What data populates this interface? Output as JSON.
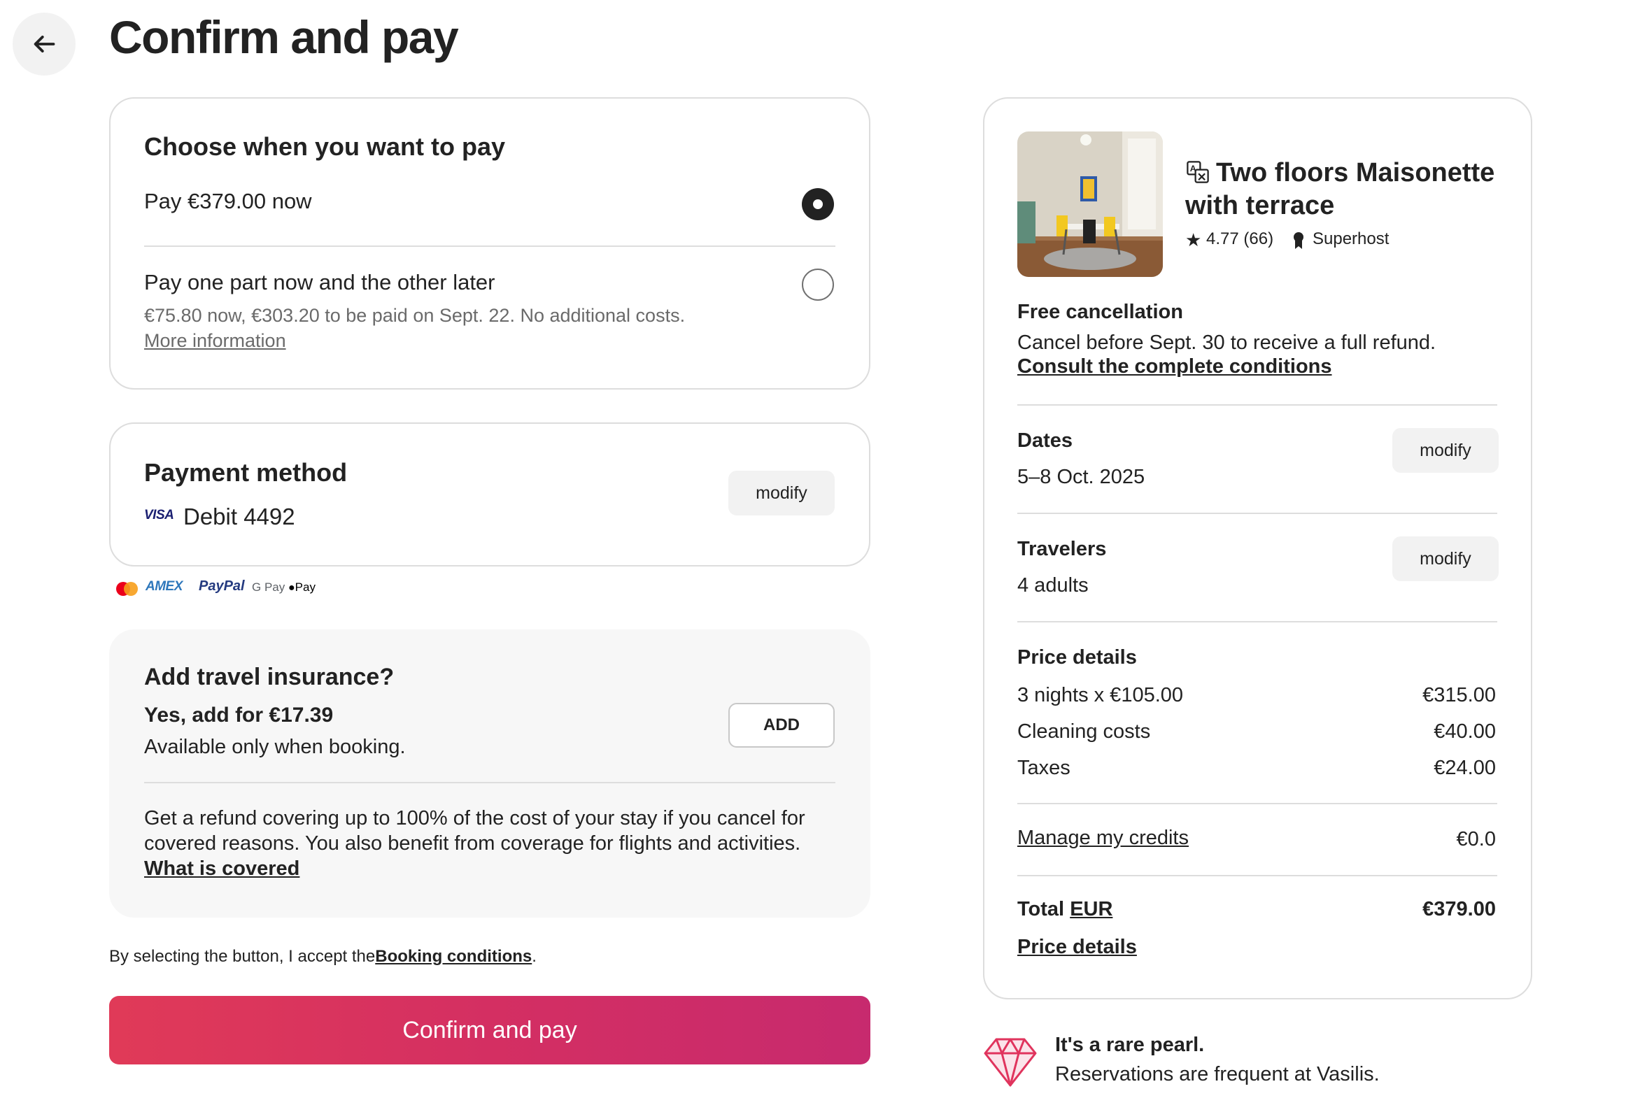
{
  "header": {
    "title": "Confirm and pay"
  },
  "pay_when": {
    "title": "Choose when you want to pay",
    "option_full": {
      "label": "Pay €379.00 now",
      "selected": true
    },
    "option_split": {
      "label": "Pay one part now and the other later",
      "detail": "€75.80 now, €303.20 to be paid on Sept. 22. No additional costs.",
      "link": "More information",
      "selected": false
    }
  },
  "payment_method": {
    "title": "Payment method",
    "card_brand": "VISA",
    "card_label": "Debit 4492",
    "modify_label": "modify",
    "accepted": [
      "AMEX",
      "PayPal",
      "G Pay",
      "Pay"
    ]
  },
  "insurance": {
    "title": "Add travel insurance?",
    "offer": "Yes, add for €17.39",
    "note": "Available only when booking.",
    "add_label": "ADD",
    "description": "Get a refund covering up to 100% of the cost of your stay if you cancel for covered reasons. You also benefit from coverage for flights and activities.",
    "link": "What is covered"
  },
  "terms": {
    "prefix": "By selecting the button, I accept the",
    "link": "Booking conditions",
    "suffix": "."
  },
  "confirm_button": {
    "label": "Confirm and pay"
  },
  "listing": {
    "title_line1": "Two floors Maisonette",
    "title_line2": "with terrace",
    "rating": "4.77 (66)",
    "host_badge": "Superhost"
  },
  "cancellation": {
    "title": "Free cancellation",
    "text": "Cancel before Sept. 30 to receive a full refund.",
    "link": "Consult the complete conditions"
  },
  "dates": {
    "label": "Dates",
    "value": "5–8 Oct. 2025",
    "modify_label": "modify"
  },
  "travelers": {
    "label": "Travelers",
    "value": "4 adults",
    "modify_label": "modify"
  },
  "price_details": {
    "title": "Price details",
    "rows": [
      {
        "label": "3 nights x €105.00",
        "amount": "€315.00"
      },
      {
        "label": "Cleaning costs",
        "amount": "€40.00"
      },
      {
        "label": "Taxes",
        "amount": "€24.00"
      }
    ],
    "credits": {
      "label": "Manage my credits",
      "amount": "€0.0"
    },
    "total": {
      "label": "Total",
      "currency": "EUR",
      "amount": "€379.00"
    },
    "details_link": "Price details"
  },
  "rare_find": {
    "title": "It's a rare pearl.",
    "text": "Reservations are frequent at Vasilis."
  },
  "colors": {
    "brand_gradient_start": "#e03a58",
    "brand_gradient_end": "#c72a6e",
    "gem": "#e0345d"
  }
}
